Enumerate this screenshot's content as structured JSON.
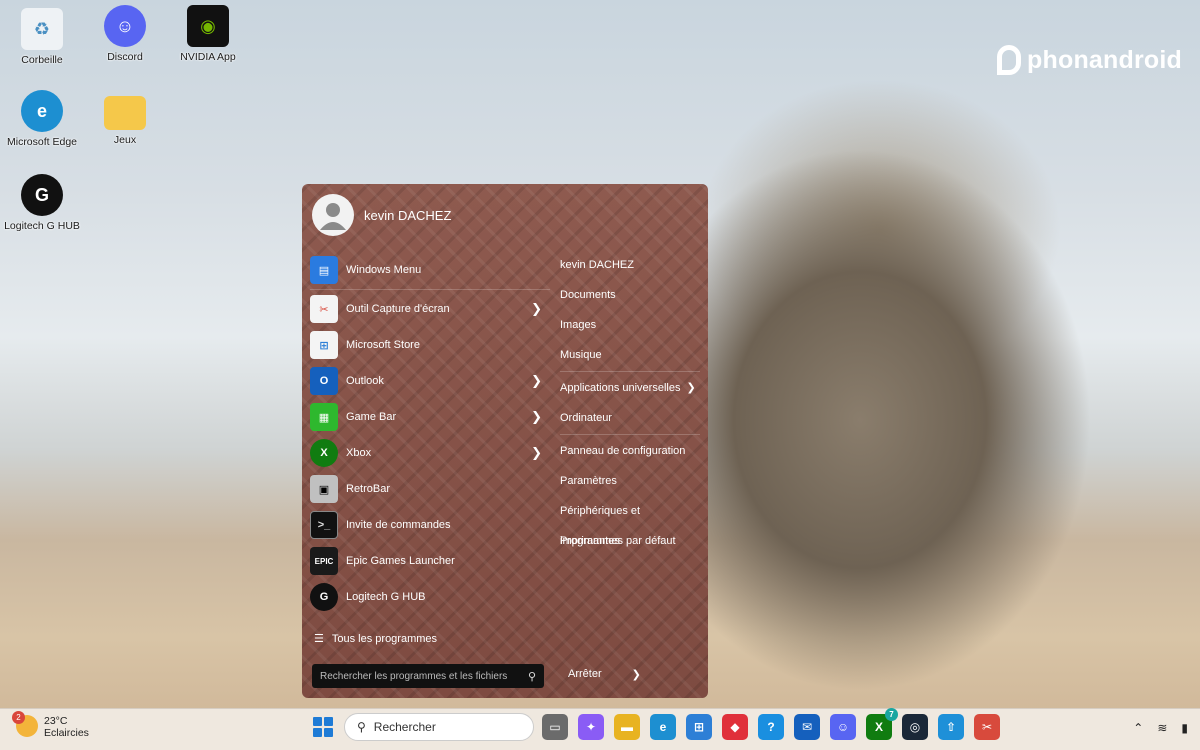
{
  "desktop": {
    "icons": [
      {
        "label": "Corbeille",
        "icon": "recycle-bin-icon"
      },
      {
        "label": "Discord",
        "icon": "discord-icon"
      },
      {
        "label": "NVIDIA App",
        "icon": "nvidia-icon"
      },
      {
        "label": "Microsoft Edge",
        "icon": "edge-icon"
      },
      {
        "label": "Jeux",
        "icon": "folder-icon"
      },
      {
        "label": "Logitech G HUB",
        "icon": "logitech-icon"
      }
    ],
    "watermark": "phonandroid"
  },
  "start_menu": {
    "user": "kevin DACHEZ",
    "programs": [
      {
        "label": "Windows Menu",
        "icon": "windows-menu-icon",
        "submenu": false
      },
      {
        "label": "Outil Capture d'écran",
        "icon": "snipping-tool-icon",
        "submenu": true
      },
      {
        "label": "Microsoft Store",
        "icon": "store-icon",
        "submenu": false
      },
      {
        "label": "Outlook",
        "icon": "outlook-icon",
        "submenu": true
      },
      {
        "label": "Game Bar",
        "icon": "game-bar-icon",
        "submenu": true
      },
      {
        "label": "Xbox",
        "icon": "xbox-icon",
        "submenu": true
      },
      {
        "label": "RetroBar",
        "icon": "retrobar-icon",
        "submenu": false
      },
      {
        "label": "Invite de commandes",
        "icon": "cmd-icon",
        "submenu": false
      },
      {
        "label": "Epic Games Launcher",
        "icon": "epic-icon",
        "submenu": false
      },
      {
        "label": "Logitech G HUB",
        "icon": "logitech-icon",
        "submenu": false
      }
    ],
    "links": [
      {
        "label": "kevin DACHEZ",
        "submenu": false
      },
      {
        "label": "Documents",
        "submenu": false
      },
      {
        "label": "Images",
        "submenu": false
      },
      {
        "label": "Musique",
        "submenu": false
      },
      {
        "label": "Applications universelles",
        "submenu": true
      },
      {
        "label": "Ordinateur",
        "submenu": false
      },
      {
        "label": "Panneau de configuration",
        "submenu": false
      },
      {
        "label": "Paramètres",
        "submenu": false
      },
      {
        "label": "Périphériques et imprimantes",
        "submenu": false
      },
      {
        "label": "Programmes par défaut",
        "submenu": false
      }
    ],
    "all_programs": "Tous les programmes",
    "search_placeholder": "Rechercher les programmes et les fichiers",
    "shutdown": "Arrêter"
  },
  "taskbar": {
    "weather_temp": "23°C",
    "weather_desc": "Eclaircies",
    "weather_badge": "2",
    "search_label": "Rechercher",
    "apps": [
      {
        "name": "task-view-icon",
        "color": "#6b6b6b",
        "glyph": "▭"
      },
      {
        "name": "copilot-icon",
        "color": "#8a5cf5",
        "glyph": "✦"
      },
      {
        "name": "explorer-icon",
        "color": "#e8b321",
        "glyph": "▬"
      },
      {
        "name": "edge-icon",
        "color": "#1d8fd1",
        "glyph": "e"
      },
      {
        "name": "store-icon",
        "color": "#2d7fd6",
        "glyph": "⊞"
      },
      {
        "name": "app-red-icon",
        "color": "#e0303a",
        "glyph": "◆"
      },
      {
        "name": "help-icon",
        "color": "#1a8fe0",
        "glyph": "?"
      },
      {
        "name": "mail-icon",
        "color": "#1560bd",
        "glyph": "✉"
      },
      {
        "name": "discord-icon",
        "color": "#5865f2",
        "glyph": "☺"
      },
      {
        "name": "xbox-icon",
        "color": "#107c10",
        "glyph": "X",
        "count": "7"
      },
      {
        "name": "steam-icon",
        "color": "#1b2838",
        "glyph": "◎"
      },
      {
        "name": "upload-icon",
        "color": "#1e90d8",
        "glyph": "⇧"
      },
      {
        "name": "snipping-tool-icon",
        "color": "#d84a3c",
        "glyph": "✂"
      }
    ]
  }
}
